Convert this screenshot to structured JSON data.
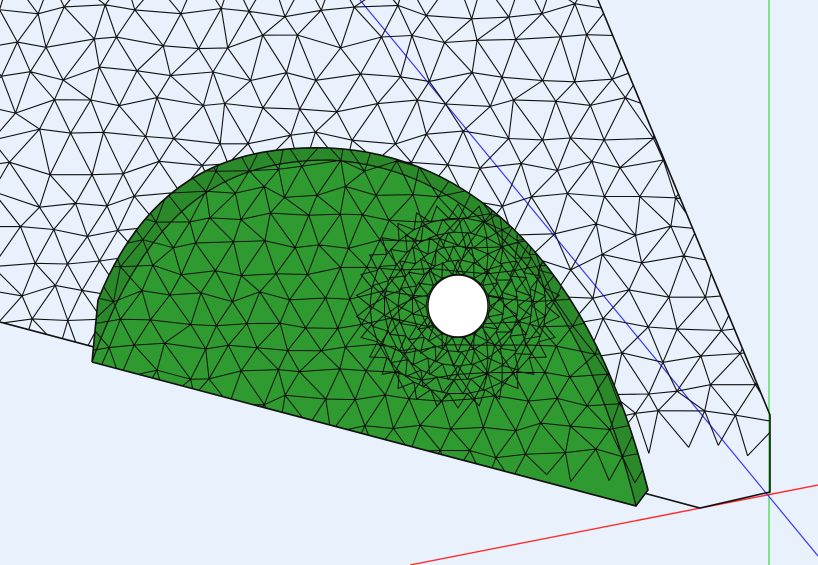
{
  "viewport": {
    "background_color": "#e8f1fc",
    "axis_colors": {
      "x_axis": "#ff2a2a",
      "y_axis": "#4fe04f",
      "z_axis": "#3a3af5"
    }
  },
  "mesh": {
    "wireframe_color": "#111111",
    "solid_fill_color": "#2f9a2f",
    "solid_side_color": "#2a8a2a",
    "hole_fill_color": "#ffffff"
  }
}
